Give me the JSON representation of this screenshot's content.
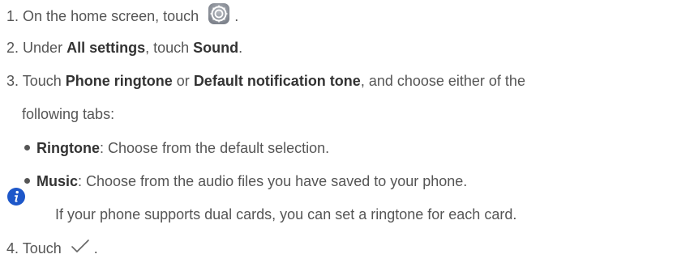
{
  "steps": {
    "step1": {
      "num": "1.",
      "text": "On the home screen, touch",
      "end": "."
    },
    "step2": {
      "num": "2.",
      "pre": "Under",
      "all_settings": "All settings",
      "mid": ", touch",
      "sound": "Sound",
      "end": "."
    },
    "step3": {
      "num": "3.",
      "pre": "Touch",
      "phone_ringtone": "Phone ringtone",
      "or": "or",
      "default_tone": "Default notification tone",
      "post": ", and choose either of the",
      "cont": "following tabs:"
    },
    "step4": {
      "num": "4.",
      "text": "Touch",
      "end": "."
    }
  },
  "tabs": [
    {
      "label": "Ringtone",
      "desc": ": Choose from the default selection."
    },
    {
      "label": "Music",
      "desc": ": Choose from the audio files you have saved to your phone."
    }
  ],
  "note": "If your phone supports dual cards, you can set a ringtone for each card.",
  "colors": {
    "info_icon": "#1d57c9",
    "settings_icon": "#8a8f98"
  },
  "icons": {
    "settings": "settings-gear-icon",
    "info": "info-icon",
    "check": "checkmark-icon"
  }
}
